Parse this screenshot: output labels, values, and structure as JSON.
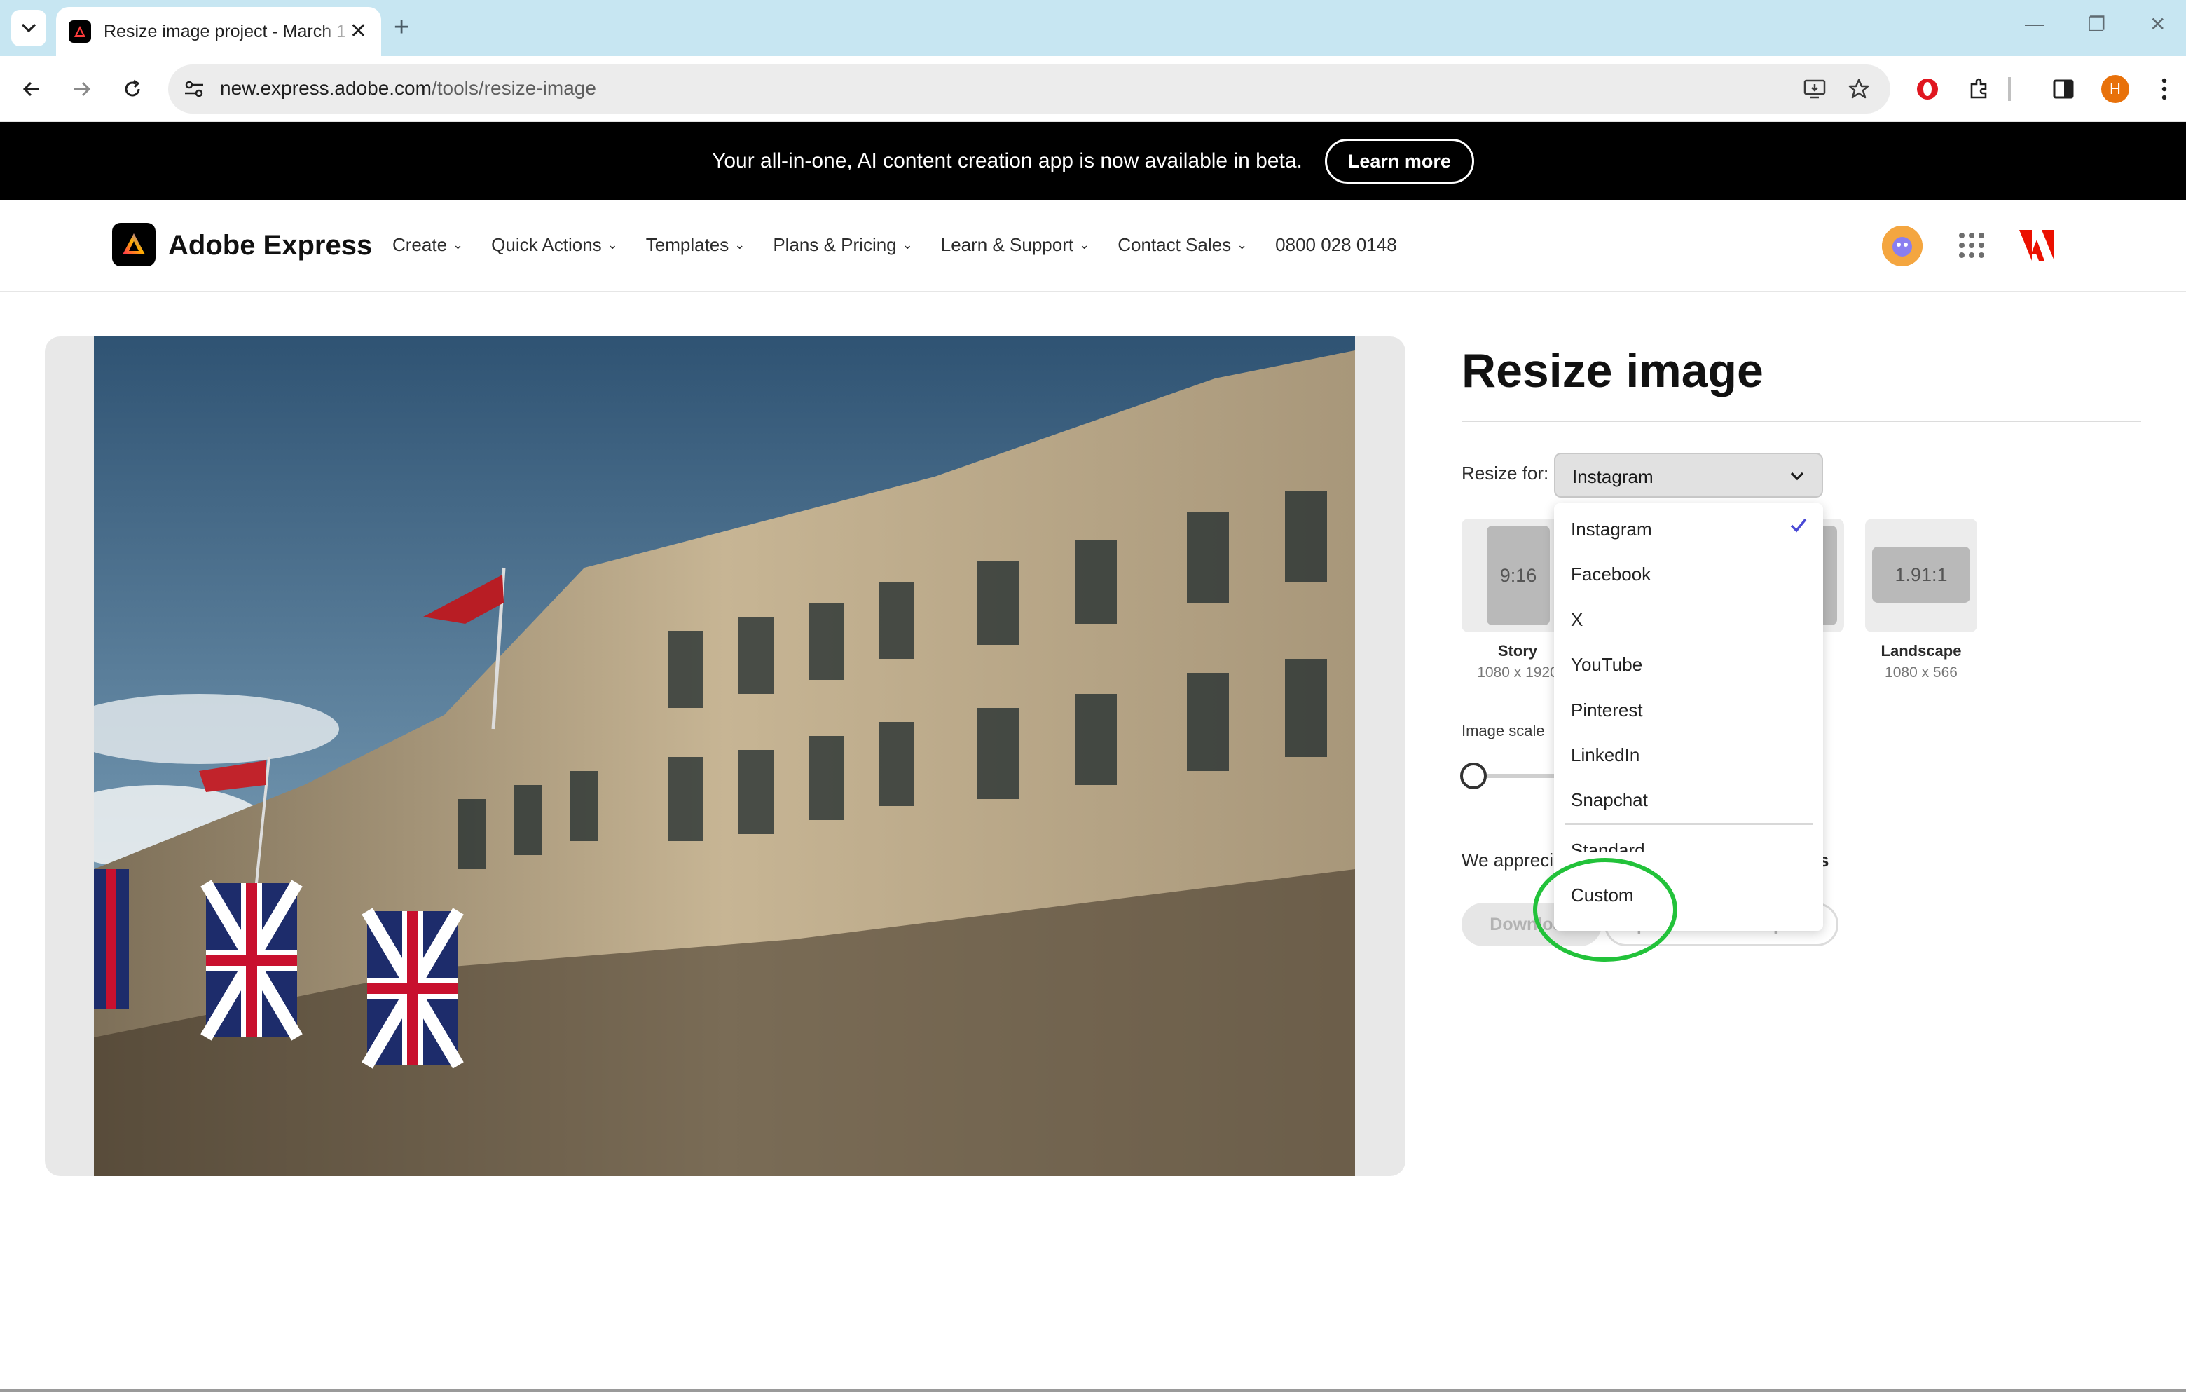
{
  "browser": {
    "tab_title": "Resize image project - March 1",
    "url_domain": "new.express.adobe.com",
    "url_path": "/tools/resize-image",
    "profile_initial": "H"
  },
  "banner": {
    "text": "Your all-in-one, AI content creation app is now available in beta.",
    "button": "Learn more"
  },
  "nav": {
    "brand": "Adobe Express",
    "links": [
      "Create",
      "Quick Actions",
      "Templates",
      "Plans & Pricing",
      "Learn & Support",
      "Contact Sales"
    ],
    "phone": "0800 028 0148"
  },
  "panel": {
    "title": "Resize image",
    "resize_label": "Resize for:",
    "selected": "Instagram",
    "presets": [
      {
        "ratio": "9:16",
        "name": "Story",
        "size": "1080 x 1920"
      },
      {
        "ratio": "1.91:1",
        "name": "Landscape",
        "size": "1080 x 566"
      }
    ],
    "scale_label": "Image scale",
    "appreciate_text": "We apprecia",
    "appreciate_tail": "s",
    "download": "Download",
    "open": "Open in Adobe Express"
  },
  "dropdown": {
    "items": [
      "Instagram",
      "Facebook",
      "X",
      "YouTube",
      "Pinterest",
      "LinkedIn",
      "Snapchat"
    ],
    "standard": "Standard",
    "custom": "Custom"
  },
  "colors": {
    "banner_bg": "#000000",
    "check": "#4a4ad6",
    "highlight_ring": "#22c23a"
  }
}
